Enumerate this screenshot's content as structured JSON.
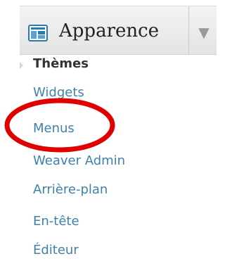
{
  "menu": {
    "section_label": "Apparence",
    "section_icon": "appearance-icon",
    "toggle_icon": "triangle-down-icon",
    "current_item": "Thèmes",
    "items": [
      {
        "label": "Widgets"
      },
      {
        "label": "Menus"
      },
      {
        "label": "Weaver Admin"
      },
      {
        "label": "Arrière-plan"
      },
      {
        "label": "En-tête"
      },
      {
        "label": "Éditeur"
      }
    ]
  },
  "annotation": {
    "highlight_target": "Menus",
    "highlight_color": "#e00000"
  },
  "colors": {
    "link": "#3e82a8",
    "current": "#333333",
    "header_bg": "#ececec"
  }
}
